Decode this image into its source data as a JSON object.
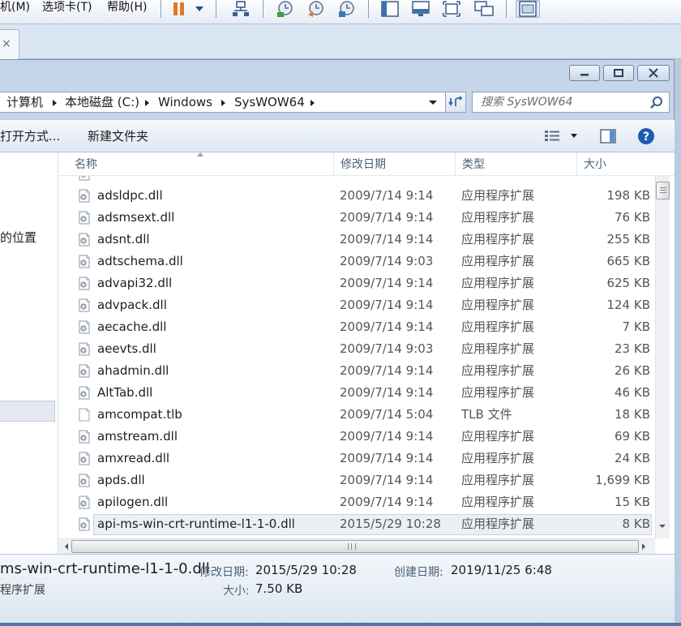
{
  "vm_menu": {
    "machine": "机(M)",
    "tabs": "选项卡(T)",
    "help": "帮助(H)"
  },
  "vm_toolbar_icons": [
    "pause-icon",
    "dropdown-icon",
    "network-icon",
    "snapshot-take-icon",
    "snapshot-revert-icon",
    "snapshot-manager-icon",
    "sidebar-icon",
    "console-view-icon",
    "fullscreen-icon",
    "unity-icon",
    "thumbnail-view-icon"
  ],
  "vm_tab": {
    "close": "×"
  },
  "window": {
    "minimize": "minimize",
    "maximize": "maximize",
    "close": "close"
  },
  "address": {
    "crumbs": [
      "计算机",
      "本地磁盘 (C:)",
      "Windows",
      "SysWOW64"
    ]
  },
  "search": {
    "placeholder": "搜索 SysWOW64"
  },
  "commands": {
    "open_with": "打开方式...",
    "new_folder": "新建文件夹"
  },
  "nav_pane": {
    "partial_label": "的位置"
  },
  "columns": {
    "name": "名称",
    "date": "修改日期",
    "type": "类型",
    "size": "大小"
  },
  "files": [
    {
      "name": "adsldpc.dll",
      "date": "2009/7/14 9:14",
      "type": "应用程序扩展",
      "size": "198 KB",
      "icon": "dll-icon"
    },
    {
      "name": "adsmsext.dll",
      "date": "2009/7/14 9:14",
      "type": "应用程序扩展",
      "size": "76 KB",
      "icon": "dll-icon"
    },
    {
      "name": "adsnt.dll",
      "date": "2009/7/14 9:14",
      "type": "应用程序扩展",
      "size": "255 KB",
      "icon": "dll-icon"
    },
    {
      "name": "adtschema.dll",
      "date": "2009/7/14 9:03",
      "type": "应用程序扩展",
      "size": "665 KB",
      "icon": "dll-icon"
    },
    {
      "name": "advapi32.dll",
      "date": "2009/7/14 9:14",
      "type": "应用程序扩展",
      "size": "625 KB",
      "icon": "dll-icon"
    },
    {
      "name": "advpack.dll",
      "date": "2009/7/14 9:14",
      "type": "应用程序扩展",
      "size": "124 KB",
      "icon": "dll-icon"
    },
    {
      "name": "aecache.dll",
      "date": "2009/7/14 9:14",
      "type": "应用程序扩展",
      "size": "7 KB",
      "icon": "dll-icon"
    },
    {
      "name": "aeevts.dll",
      "date": "2009/7/14 9:03",
      "type": "应用程序扩展",
      "size": "23 KB",
      "icon": "dll-icon"
    },
    {
      "name": "ahadmin.dll",
      "date": "2009/7/14 9:14",
      "type": "应用程序扩展",
      "size": "26 KB",
      "icon": "dll-icon"
    },
    {
      "name": "AltTab.dll",
      "date": "2009/7/14 9:14",
      "type": "应用程序扩展",
      "size": "46 KB",
      "icon": "dll-icon"
    },
    {
      "name": "amcompat.tlb",
      "date": "2009/7/14 5:04",
      "type": "TLB 文件",
      "size": "18 KB",
      "icon": "file-icon"
    },
    {
      "name": "amstream.dll",
      "date": "2009/7/14 9:14",
      "type": "应用程序扩展",
      "size": "69 KB",
      "icon": "dll-icon"
    },
    {
      "name": "amxread.dll",
      "date": "2009/7/14 9:14",
      "type": "应用程序扩展",
      "size": "24 KB",
      "icon": "dll-icon"
    },
    {
      "name": "apds.dll",
      "date": "2009/7/14 9:14",
      "type": "应用程序扩展",
      "size": "1,699 KB",
      "icon": "dll-icon"
    },
    {
      "name": "apilogen.dll",
      "date": "2009/7/14 9:14",
      "type": "应用程序扩展",
      "size": "15 KB",
      "icon": "dll-icon"
    },
    {
      "name": "api-ms-win-crt-runtime-l1-1-0.dll",
      "date": "2015/5/29 10:28",
      "type": "应用程序扩展",
      "size": "8 KB",
      "icon": "dll-icon",
      "selected": true
    }
  ],
  "details": {
    "filename": "ms-win-crt-runtime-l1-1-0.dll",
    "filetype": "程序扩展",
    "modified_label": "修改日期:",
    "modified_value": "2015/5/29 10:28",
    "created_label": "创建日期:",
    "created_value": "2019/11/25 6:48",
    "size_label": "大小:",
    "size_value": "7.50 KB"
  },
  "colors": {
    "header_text": "#4c607a",
    "selection_bg": "#ecf0f5",
    "help_blue": "#1e5bb5",
    "frame": "#c5d6ea"
  }
}
